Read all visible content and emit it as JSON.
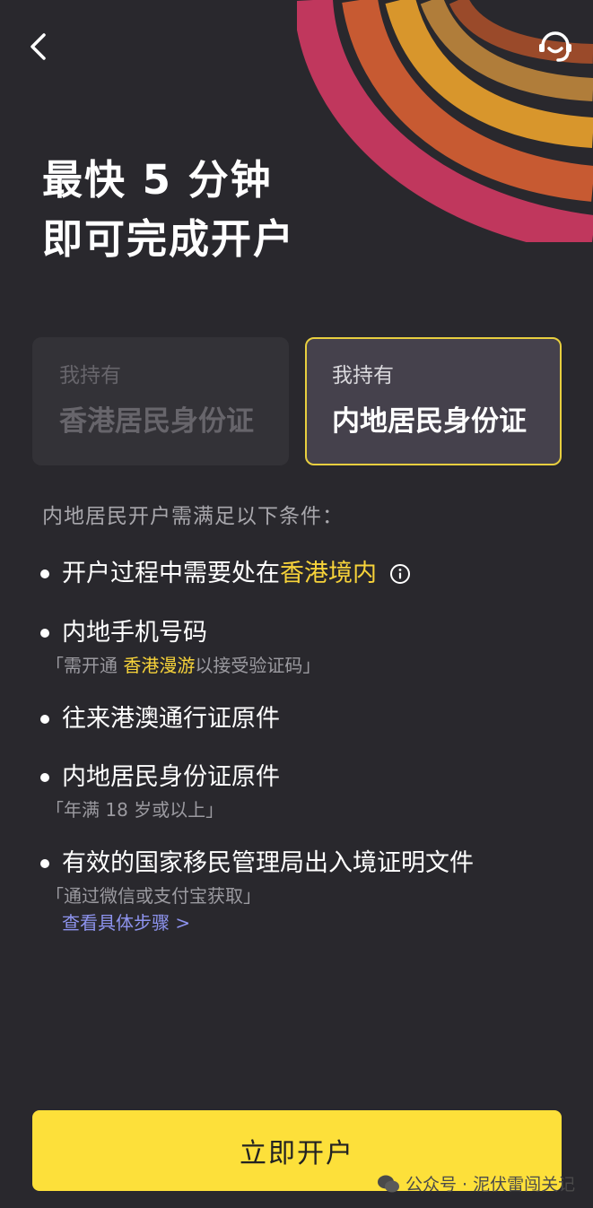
{
  "nav": {
    "back_icon": "chevron-left-icon",
    "support_icon": "customer-service-headset-icon"
  },
  "headline": {
    "line1": "最快 5 分钟",
    "line2": "即可完成开户"
  },
  "id_options": [
    {
      "small": "我持有",
      "big": "香港居民身份证",
      "selected": false
    },
    {
      "small": "我持有",
      "big": "内地居民身份证",
      "selected": true
    }
  ],
  "conditions": {
    "title": "内地居民开户需满足以下条件：",
    "item1": {
      "text_before": "开户过程中需要处在",
      "highlight": "香港境内"
    },
    "item2": {
      "text": "内地手机号码",
      "sub_before": "「需开通 ",
      "sub_highlight": "香港漫游",
      "sub_after": "以接受验证码」"
    },
    "item3": {
      "text": "往来港澳通行证原件"
    },
    "item4": {
      "text": "内地居民身份证原件",
      "sub": "「年满 18 岁或以上」"
    },
    "item5": {
      "text": "有效的国家移民管理局出入境证明文件",
      "sub": "「通过微信或支付宝获取」",
      "link": "查看具体步骤 >"
    }
  },
  "cta_label": "立即开户",
  "watermark": "公众号 · 泥伏雷闯关记",
  "colors": {
    "background": "#29282d",
    "accent_yellow": "#fde03a",
    "highlight_yellow": "#f7d33a",
    "link_purple": "#8d93ee",
    "selected_border": "#e8cf3f"
  }
}
